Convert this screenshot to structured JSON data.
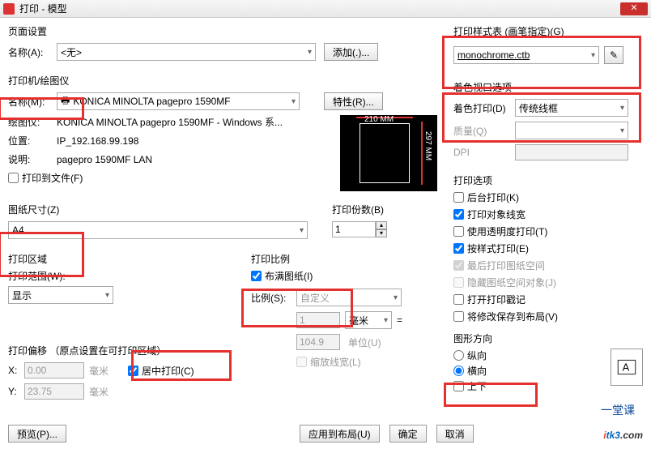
{
  "window": {
    "title": "打印 - 模型"
  },
  "page_setup": {
    "heading": "页面设置",
    "name_label": "名称(A):",
    "name_value": "<无>",
    "add_btn": "添加(.)..."
  },
  "plotter": {
    "heading": "打印机/绘图仪",
    "name_label": "名称(M):",
    "name_value": "KONICA MINOLTA pagepro 1590MF",
    "props_btn": "特性(R)...",
    "device_label": "绘图仪:",
    "device_value": "KONICA MINOLTA pagepro 1590MF - Windows 系...",
    "location_label": "位置:",
    "location_value": "IP_192.168.99.198",
    "desc_label": "说明:",
    "desc_value": "pagepro 1590MF LAN",
    "to_file": "打印到文件(F)",
    "preview_width": "210 MM",
    "preview_height": "297 MM"
  },
  "paper": {
    "heading": "图纸尺寸(Z)",
    "value": "A4"
  },
  "copies": {
    "heading": "打印份数(B)",
    "value": "1"
  },
  "area": {
    "heading": "打印区域",
    "range_label": "打印范围(W):",
    "range_value": "显示"
  },
  "scale": {
    "heading": "打印比例",
    "fit": "布满图纸(I)",
    "ratio_label": "比例(S):",
    "ratio_value": "自定义",
    "num": "1",
    "unit_sel": "毫米",
    "eq": "=",
    "den": "104.9",
    "unit_label": "单位(U)",
    "scale_lw": "缩放线宽(L)"
  },
  "offset": {
    "heading": "打印偏移 （原点设置在可打印区域）",
    "x_label": "X:",
    "x_val": "0.00",
    "x_unit": "毫米",
    "y_label": "Y:",
    "y_val": "23.75",
    "y_unit": "毫米",
    "center": "居中打印(C)"
  },
  "style": {
    "heading": "打印样式表 (画笔指定)(G)",
    "value": "monochrome.ctb"
  },
  "viewport": {
    "heading": "着色视口选项",
    "shade_label": "着色打印(D)",
    "shade_value": "传统线框",
    "quality_label": "质量(Q)",
    "dpi_label": "DPI"
  },
  "options": {
    "heading": "打印选项",
    "bg": "后台打印(K)",
    "lw": "打印对象线宽",
    "trans": "使用透明度打印(T)",
    "bystyle": "按样式打印(E)",
    "last": "最后打印图纸空间",
    "hide": "隐藏图纸空间对象(J)",
    "stamp": "打开打印戳记",
    "save": "将修改保存到布局(V)"
  },
  "orientation": {
    "heading": "图形方向",
    "portrait": "纵向",
    "landscape": "横向",
    "upside": "上下"
  },
  "footer": {
    "preview": "预览(P)...",
    "apply": "应用到布局(U)",
    "ok": "确定",
    "cancel": "取消"
  }
}
